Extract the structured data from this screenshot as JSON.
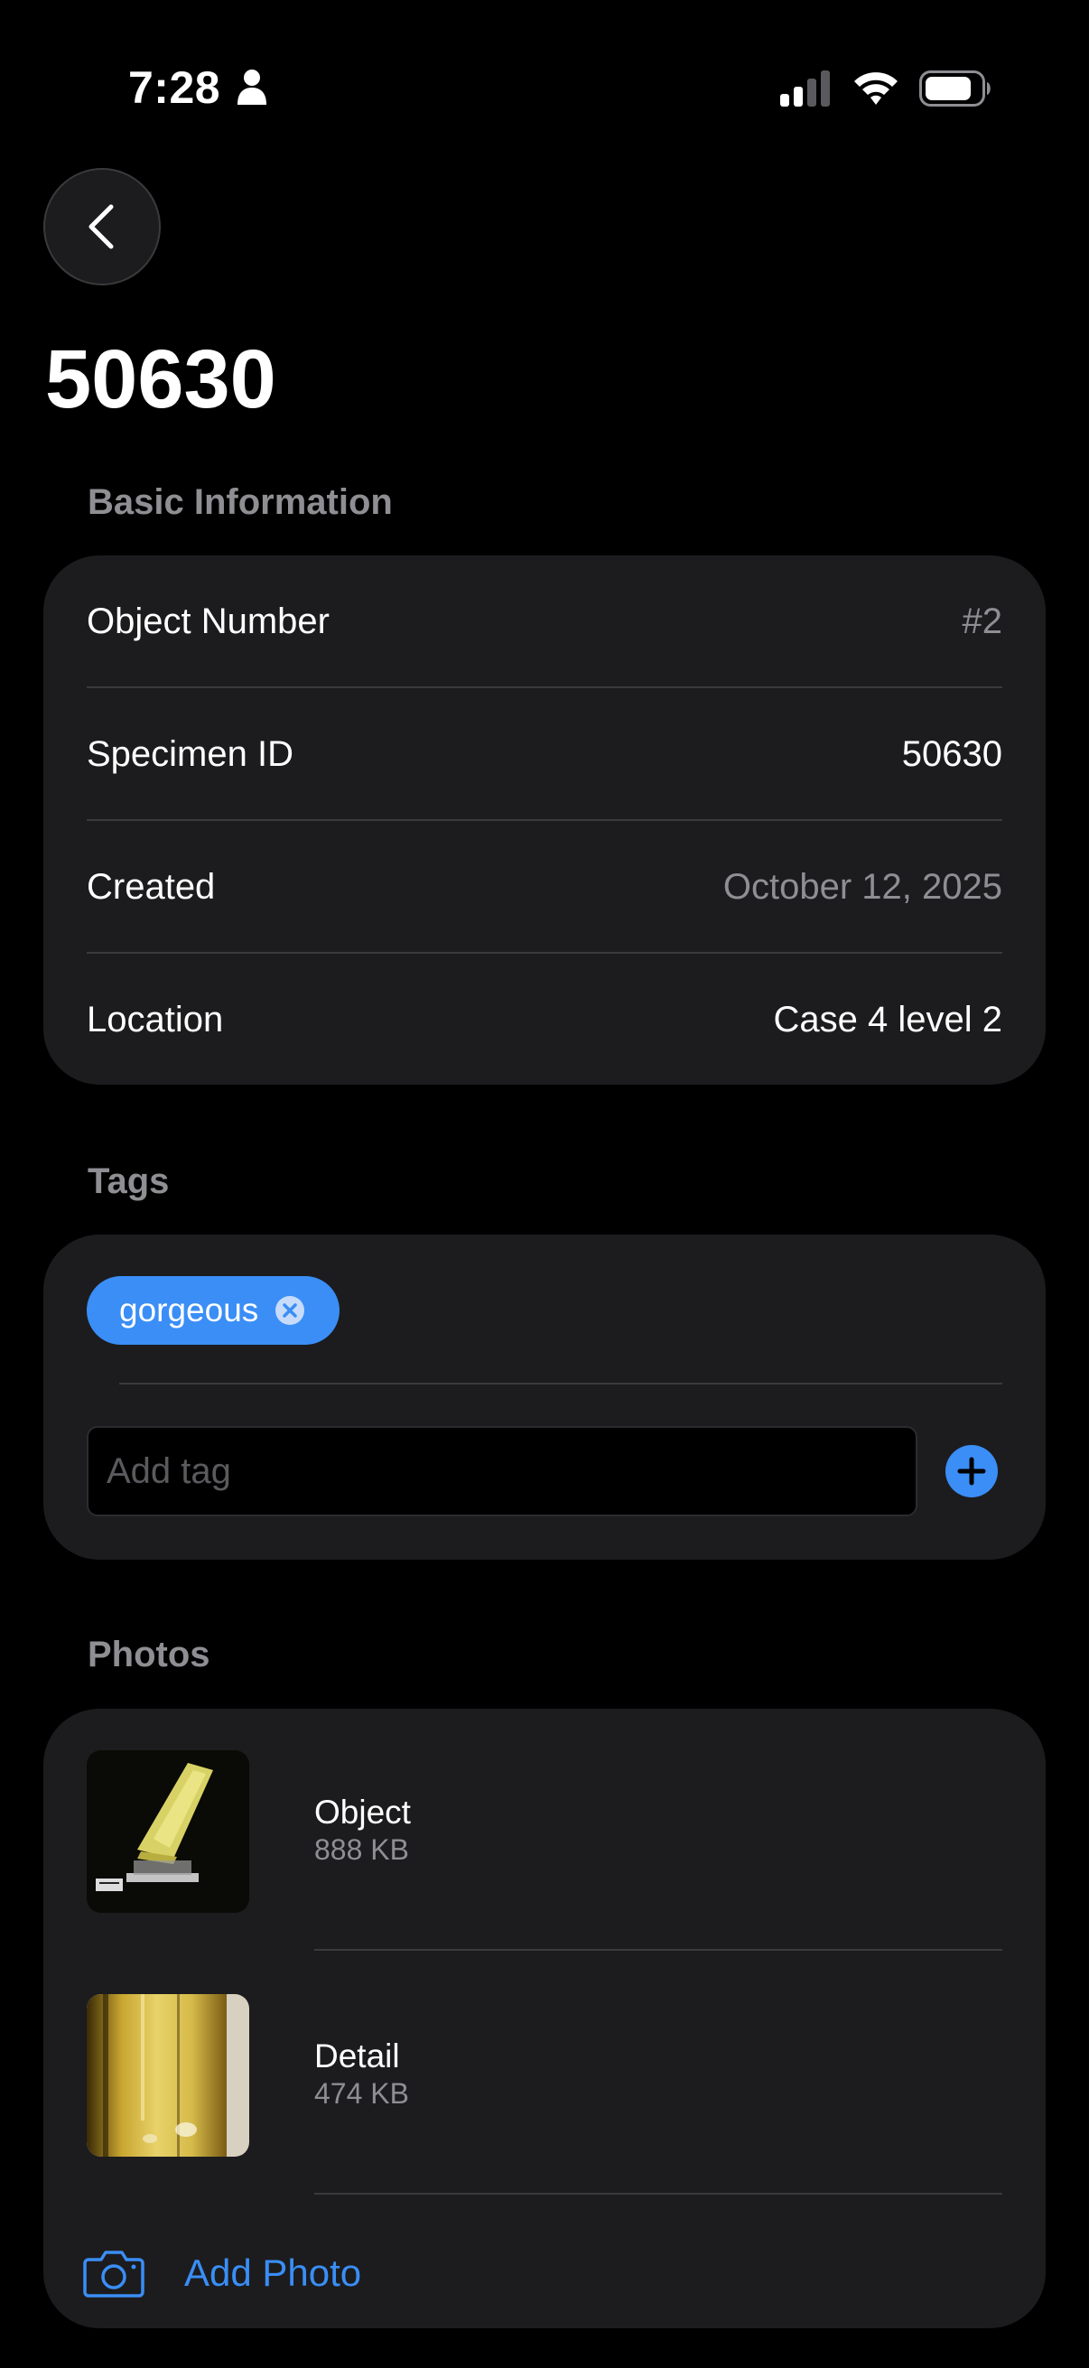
{
  "status_bar": {
    "time": "7:28",
    "icons": [
      "person-icon",
      "cellular-signal-icon",
      "wifi-icon",
      "battery-icon"
    ]
  },
  "nav": {
    "back_icon": "chevron-left-icon"
  },
  "page": {
    "title": "50630"
  },
  "basic_information": {
    "header": "Basic Information",
    "rows": [
      {
        "label": "Object Number",
        "value": "#2",
        "muted": true
      },
      {
        "label": "Specimen ID",
        "value": "50630",
        "muted": false
      },
      {
        "label": "Created",
        "value": "October 12, 2025",
        "muted": true
      },
      {
        "label": "Location",
        "value": "Case 4 level 2",
        "muted": false
      }
    ]
  },
  "tags": {
    "header": "Tags",
    "items": [
      {
        "label": "gorgeous"
      }
    ],
    "input_placeholder": "Add tag",
    "input_value": ""
  },
  "photos": {
    "header": "Photos",
    "items": [
      {
        "title": "Object",
        "size": "888 KB"
      },
      {
        "title": "Detail",
        "size": "474 KB"
      }
    ],
    "add_label": "Add Photo"
  },
  "colors": {
    "background": "#000000",
    "card": "#1c1c1e",
    "accent": "#3a8ef6",
    "secondary_text": "#8e8e93",
    "divider": "#3a3a3c"
  }
}
